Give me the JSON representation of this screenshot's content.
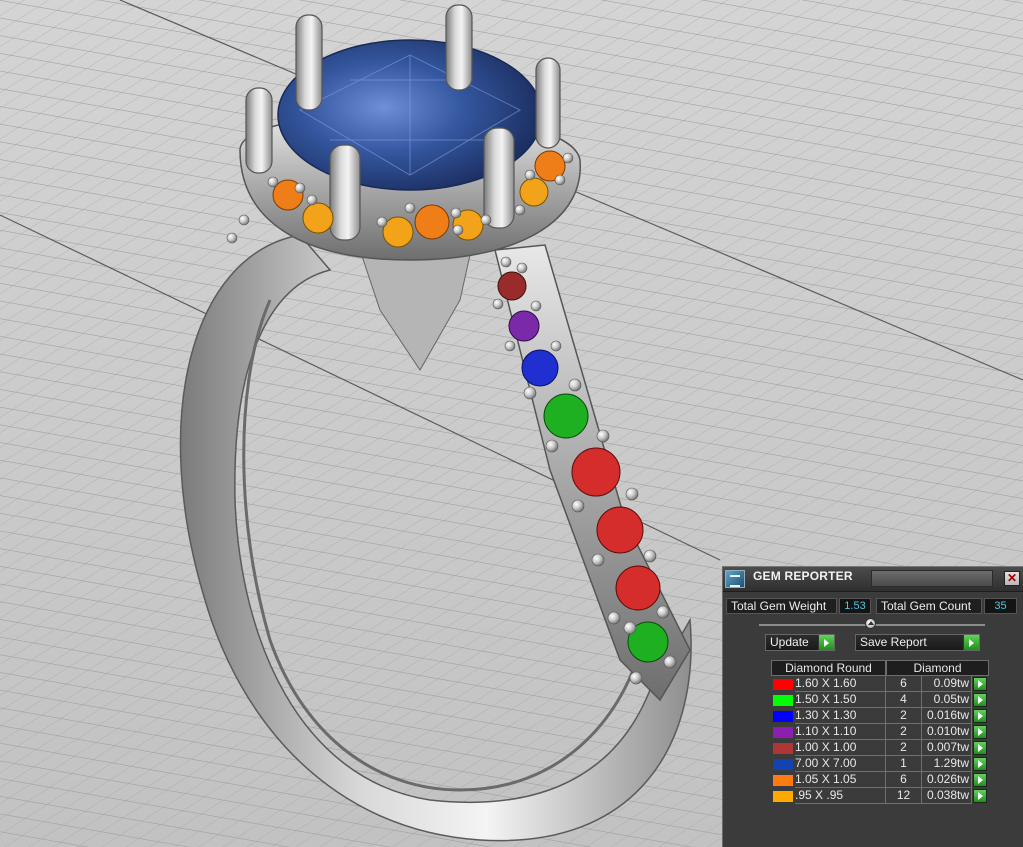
{
  "panel": {
    "title": "GEM REPORTER",
    "close_glyph": "✕",
    "total_weight_label": "Total Gem Weight",
    "total_weight_value": "1.53",
    "total_count_label": "Total Gem Count",
    "total_count_value": "35",
    "update_label": "Update",
    "save_report_label": "Save Report"
  },
  "table": {
    "header_shape": "Diamond Round",
    "header_material": "Diamond",
    "rows": [
      {
        "color": "#ff0000",
        "size": "1.60 X 1.60",
        "count": "6",
        "weight": "0.09tw"
      },
      {
        "color": "#00ff00",
        "size": "1.50 X 1.50",
        "count": "4",
        "weight": "0.05tw"
      },
      {
        "color": "#0000ff",
        "size": "1.30 X 1.30",
        "count": "2",
        "weight": "0.016tw"
      },
      {
        "color": "#8a1fb0",
        "size": "1.10 X 1.10",
        "count": "2",
        "weight": "0.010tw"
      },
      {
        "color": "#b03535",
        "size": "1.00 X 1.00",
        "count": "2",
        "weight": "0.007tw"
      },
      {
        "color": "#1144b0",
        "size": "7.00 X 7.00",
        "count": "1",
        "weight": "1.29tw"
      },
      {
        "color": "#ff7a10",
        "size": "1.05 X 1.05",
        "count": "6",
        "weight": "0.026tw"
      },
      {
        "color": "#ffa800",
        "size": ".95 X .95",
        "count": "12",
        "weight": "0.038tw"
      }
    ]
  },
  "icons": {
    "app": "gem-reporter-app-icon",
    "close": "close-icon",
    "play": "play-arrow-icon",
    "slider": "slider-knob-icon"
  },
  "colors": {
    "panel_bg": "#3b3b3b",
    "value_text": "#4fc9e0",
    "arrow_green": "#2fb02a",
    "metal": "#a8a8a8",
    "center_stone": "#2e4f96"
  }
}
